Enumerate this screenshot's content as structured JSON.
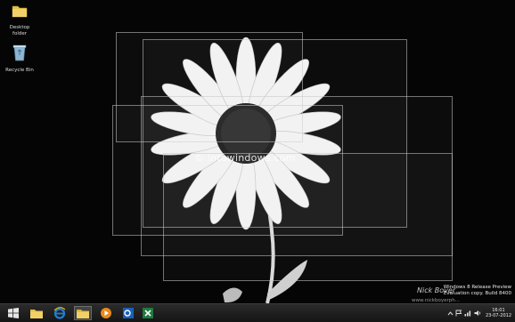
{
  "desktop": {
    "icons": [
      {
        "label": "Desktop folder",
        "icon": "folder-icon"
      },
      {
        "label": "Recycle Bin",
        "icon": "recycle-bin-icon"
      }
    ],
    "watermark": "© intowindows.com",
    "signature": "Nick Bover",
    "signature_url": "www.nickboyerph...",
    "build_info": {
      "line1": "Windows 8 Release Preview",
      "line2": "Evaluation copy. Build 8400"
    }
  },
  "taskbar": {
    "buttons": [
      {
        "icon": "windows-start-icon",
        "active": false
      },
      {
        "icon": "file-explorer-icon",
        "active": false
      },
      {
        "icon": "internet-explorer-icon",
        "active": false
      },
      {
        "icon": "folder-icon",
        "active": true
      },
      {
        "icon": "media-player-icon",
        "active": false
      },
      {
        "icon": "outlook-icon",
        "active": false
      },
      {
        "icon": "excel-icon",
        "active": false
      }
    ],
    "tray": {
      "icons": [
        "chevron-up-icon",
        "flag-icon",
        "network-icon",
        "volume-icon"
      ],
      "time": "16:01",
      "date": "23-07-2012"
    }
  },
  "colors": {
    "taskbar": "#1c1c1c",
    "desktop_bg": "#000000",
    "ie_blue": "#1e7fd6",
    "folder_yellow": "#e8c04a",
    "outlook_blue": "#1b5fb5",
    "excel_green": "#1f7a3e"
  }
}
